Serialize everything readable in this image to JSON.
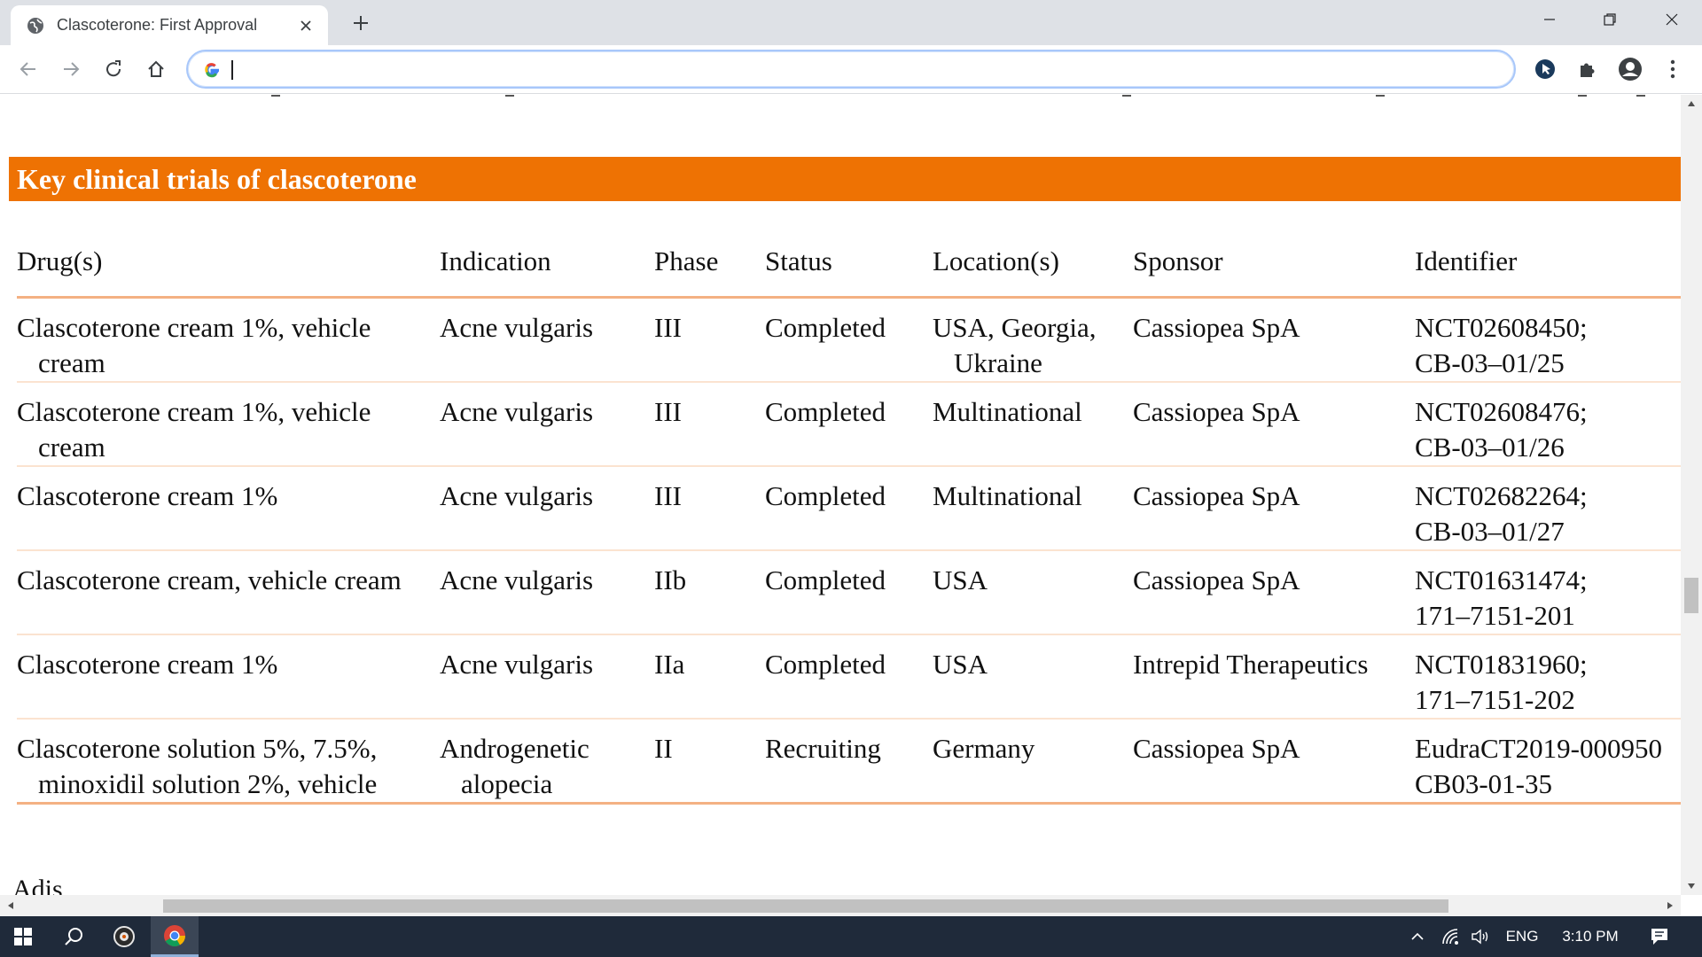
{
  "browser": {
    "tab_title": "Clascoterone: First Approval",
    "address_value": "",
    "favicon": "globe-icon"
  },
  "page": {
    "section_title": "Key clinical trials of clascoterone",
    "table": {
      "headers": [
        "Drug(s)",
        "Indication",
        "Phase",
        "Status",
        "Location(s)",
        "Sponsor",
        "Identifier"
      ],
      "rows": [
        [
          "Clascoterone cream 1%, vehicle cream",
          "Acne vulgaris",
          "III",
          "Completed",
          "USA, Georgia, Ukraine",
          "Cassiopea SpA",
          "NCT02608450;",
          "CB-03–01/25"
        ],
        [
          "Clascoterone cream 1%, vehicle cream",
          "Acne vulgaris",
          "III",
          "Completed",
          "Multinational",
          "Cassiopea SpA",
          "NCT02608476;",
          "CB-03–01/26"
        ],
        [
          "Clascoterone cream 1%",
          "Acne vulgaris",
          "III",
          "Completed",
          "Multinational",
          "Cassiopea SpA",
          "NCT02682264;",
          "CB-03–01/27"
        ],
        [
          "Clascoterone cream, vehicle cream",
          "Acne vulgaris",
          "IIb",
          "Completed",
          "USA",
          "Cassiopea SpA",
          "NCT01631474;",
          "171–7151-201"
        ],
        [
          "Clascoterone cream 1%",
          "Acne vulgaris",
          "IIa",
          "Completed",
          "USA",
          "Intrepid Therapeutics",
          "NCT01831960;",
          "171–7151-202"
        ],
        [
          "Clascoterone solution 5%, 7.5%, minoxidil solution 2%, vehicle",
          "Androgenetic alopecia",
          "II",
          "Recruiting",
          "Germany",
          "Cassiopea SpA",
          "EudraCT2019-000950",
          "CB03-01-35"
        ]
      ]
    },
    "next_heading_partial": "Adis"
  },
  "taskbar": {
    "language": "ENG",
    "time": "3:10 PM"
  },
  "colors": {
    "section_header_bg": "#ee7203",
    "rule_color": "#f4b183",
    "taskbar_bg": "#1f2a3a"
  }
}
